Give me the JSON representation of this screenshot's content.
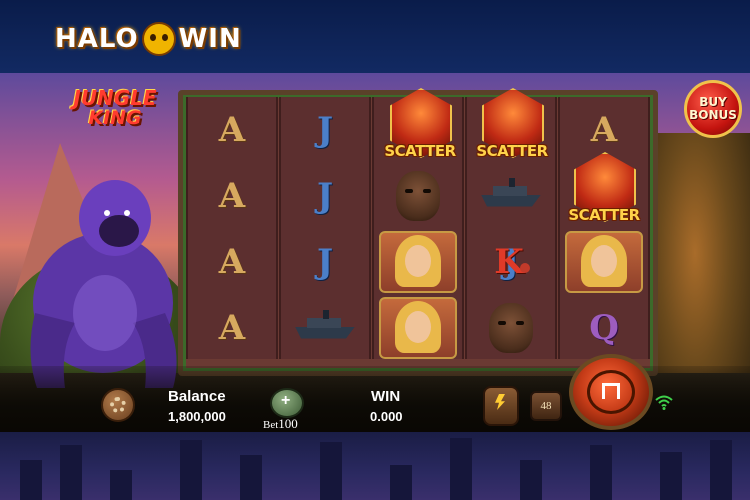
{
  "site_logo": {
    "text_left": "HALO",
    "text_right": "WIN"
  },
  "game_logo": {
    "line1": "JUNGLE",
    "line2": "KING"
  },
  "buy_bonus": {
    "line1": "BUY",
    "line2": "BONUS"
  },
  "reels": [
    [
      "A",
      "A",
      "A",
      "A"
    ],
    [
      "J",
      "J",
      "J",
      "ship"
    ],
    [
      "scatter",
      "mask",
      "woman",
      "woman"
    ],
    [
      "scatter",
      "ship",
      "J",
      "mask"
    ],
    [
      "A",
      "scatter",
      "K",
      "Q"
    ]
  ],
  "scatter_label": "SCATTER",
  "controls": {
    "balance_label": "Balance",
    "balance_value": "1,800,000",
    "bet_prefix": "Bet",
    "bet_value": "100",
    "win_label": "WIN",
    "win_value": "0.000",
    "autoplay_count": "48"
  },
  "colors": {
    "scatter_text": "#ffd34a",
    "buy_bonus_bg": "#c4140f",
    "spin_button": "#c63c18"
  },
  "icons": {
    "settings": "gear-icon",
    "bet": "coins-icon",
    "turbo": "lightning-icon",
    "spin": "spin-icon",
    "wifi": "wifi-icon"
  }
}
